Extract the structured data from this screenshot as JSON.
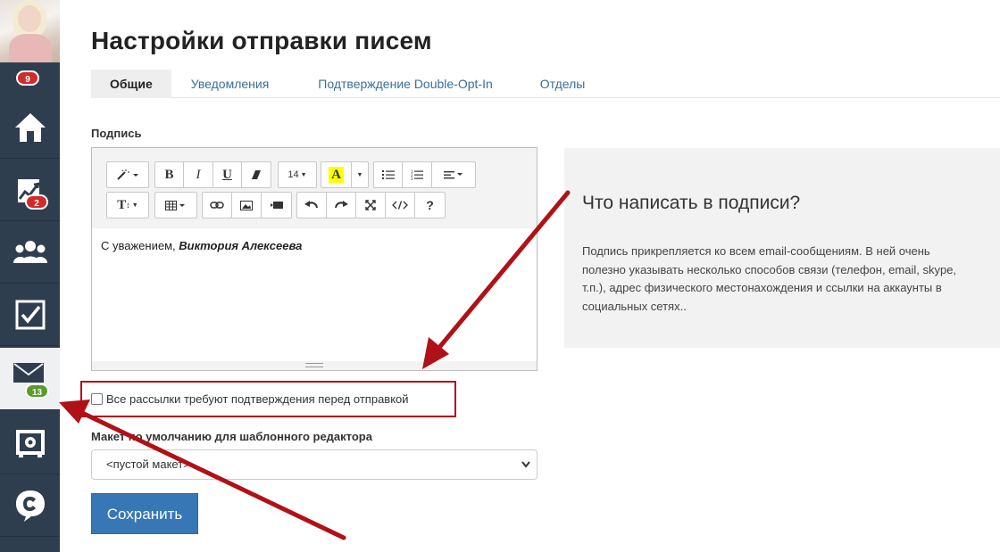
{
  "sidebar": {
    "top_badge": "9",
    "items": [
      {
        "icon": "home-icon"
      },
      {
        "icon": "chart-icon",
        "badge": "2"
      },
      {
        "icon": "users-icon"
      },
      {
        "icon": "tasks-icon"
      },
      {
        "icon": "mail-icon",
        "badge": "13",
        "active": true
      },
      {
        "icon": "safe-icon"
      },
      {
        "icon": "chat-icon"
      }
    ]
  },
  "page": {
    "title": "Настройки отправки писем"
  },
  "tabs": [
    {
      "label": "Общие",
      "active": true
    },
    {
      "label": "Уведомления"
    },
    {
      "label": "Подтверждение Double-Opt-In"
    },
    {
      "label": "Отделы"
    }
  ],
  "signature": {
    "label": "Подпись",
    "font_size": "14",
    "text_prefix": "С уважением, ",
    "text_name": "Виктория Алексеева"
  },
  "toolbar": {
    "bold": "B",
    "italic": "I",
    "underline": "U",
    "font_color": "A",
    "text_height": "T",
    "help": "?"
  },
  "options": {
    "confirm_label": "Все рассылки требуют подтверждения перед отправкой",
    "template_label": "Макет по умолчанию для шаблонного редактора",
    "template_value": "<пустой макет>"
  },
  "actions": {
    "save_label": "Сохранить"
  },
  "info": {
    "title": "Что написать в подписи?",
    "text": "Подпись прикрепляется ко всем email-сообщениям. В ней очень полезно указывать несколько способов связи (телефон, email, skype, т.п.), адрес физического местонахождения и ссылки на аккаунты в социальных сетях.."
  },
  "colors": {
    "sidebar_bg": "#2f3e4f",
    "accent": "#3777b5",
    "annotation": "#b01116"
  }
}
